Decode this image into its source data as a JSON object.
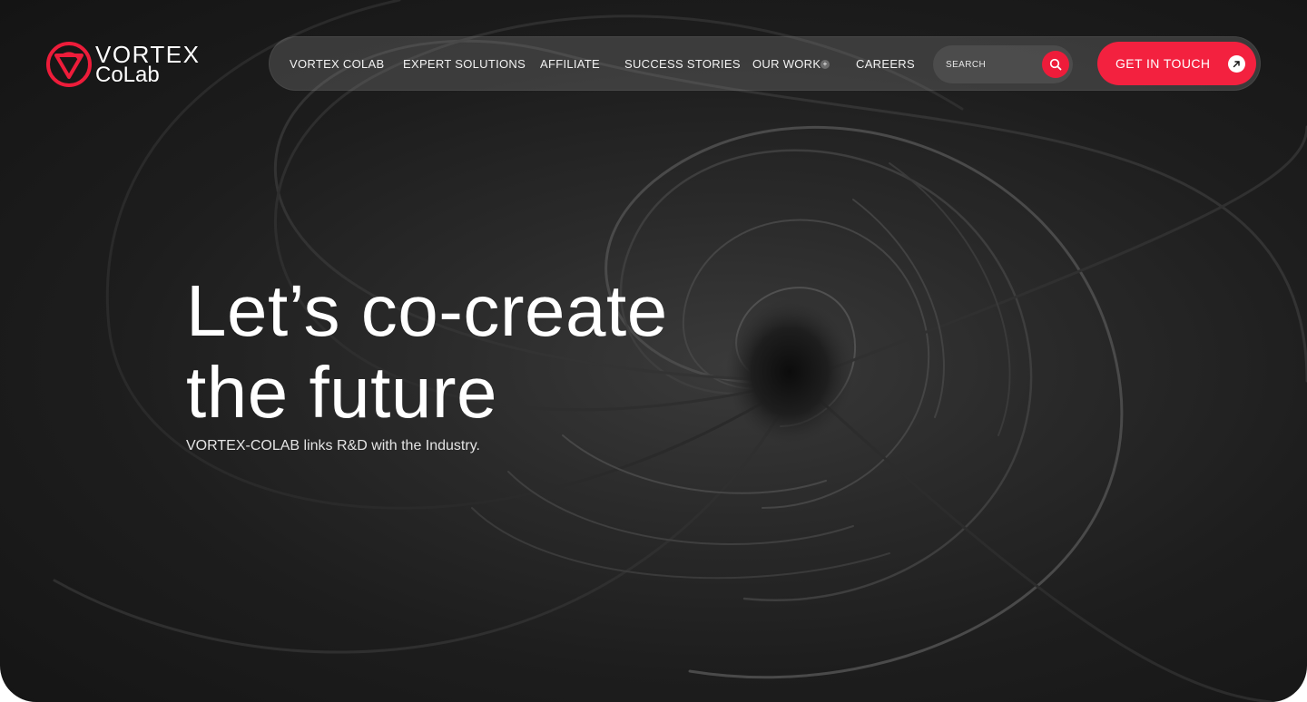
{
  "brand": {
    "name_line1": "VORTEX",
    "name_line2": "CoLab",
    "accent_color": "#ee1c3a"
  },
  "nav": {
    "items": [
      {
        "label": "VORTEX COLAB"
      },
      {
        "label": "EXPERT SOLUTIONS"
      },
      {
        "label": "AFFILIATE"
      },
      {
        "label": "SUCCESS STORIES"
      },
      {
        "label": "OUR WORK",
        "has_dropdown": true
      },
      {
        "label": "CAREERS"
      }
    ],
    "dropdown_icon": "plus-icon",
    "search": {
      "placeholder": "SEARCH",
      "icon": "search-icon"
    },
    "cta": {
      "label": "GET IN TOUCH",
      "icon": "arrow-up-right-icon"
    }
  },
  "hero": {
    "title_line1": "Let’s co-create",
    "title_line2": "the future",
    "subtitle": "VORTEX-COLAB links R&D with the Industry."
  },
  "colors": {
    "background": "#1d1d1d",
    "cta": "#f3213f",
    "text": "#ffffff"
  }
}
